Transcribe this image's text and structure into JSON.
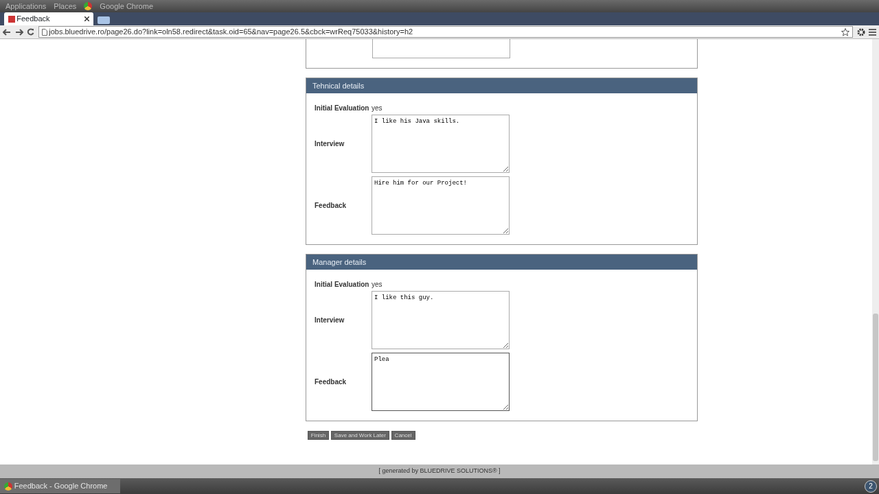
{
  "desktop_panel": {
    "menus": [
      "Applications",
      "Places"
    ],
    "app": "Google Chrome"
  },
  "browser": {
    "tabs": [
      {
        "label": "Feedback",
        "selected": true
      }
    ],
    "url": "jobs.bluedrive.ro/page26.do?link=oln58.redirect&task.oid=65&nav=page26.5&cbck=wrReq75033&history=h2"
  },
  "sections": [
    {
      "title": "Tehnical details",
      "evaluation_label": "Initial Evaluation",
      "evaluation": "yes",
      "fields": [
        {
          "label": "Interview",
          "value": "I like his Java skills.",
          "focused": false
        },
        {
          "label": "Feedback",
          "value": "Hire him for our Project!",
          "focused": false
        }
      ]
    },
    {
      "title": "Manager details",
      "evaluation_label": "Initial Evaluation",
      "evaluation": "yes",
      "fields": [
        {
          "label": "Interview",
          "value": "I like this guy.",
          "focused": false
        },
        {
          "label": "Feedback",
          "value": "Plea",
          "focused": true
        }
      ]
    }
  ],
  "buttons": [
    "Finish",
    "Save and Work Later",
    "Cancel"
  ],
  "footer": "[ generated by BLUEDRIVE SOLUTIONS® ]",
  "taskbar": {
    "windows": [
      {
        "label": "Feedback - Google Chrome",
        "selected": true
      }
    ],
    "workspace": "2"
  }
}
